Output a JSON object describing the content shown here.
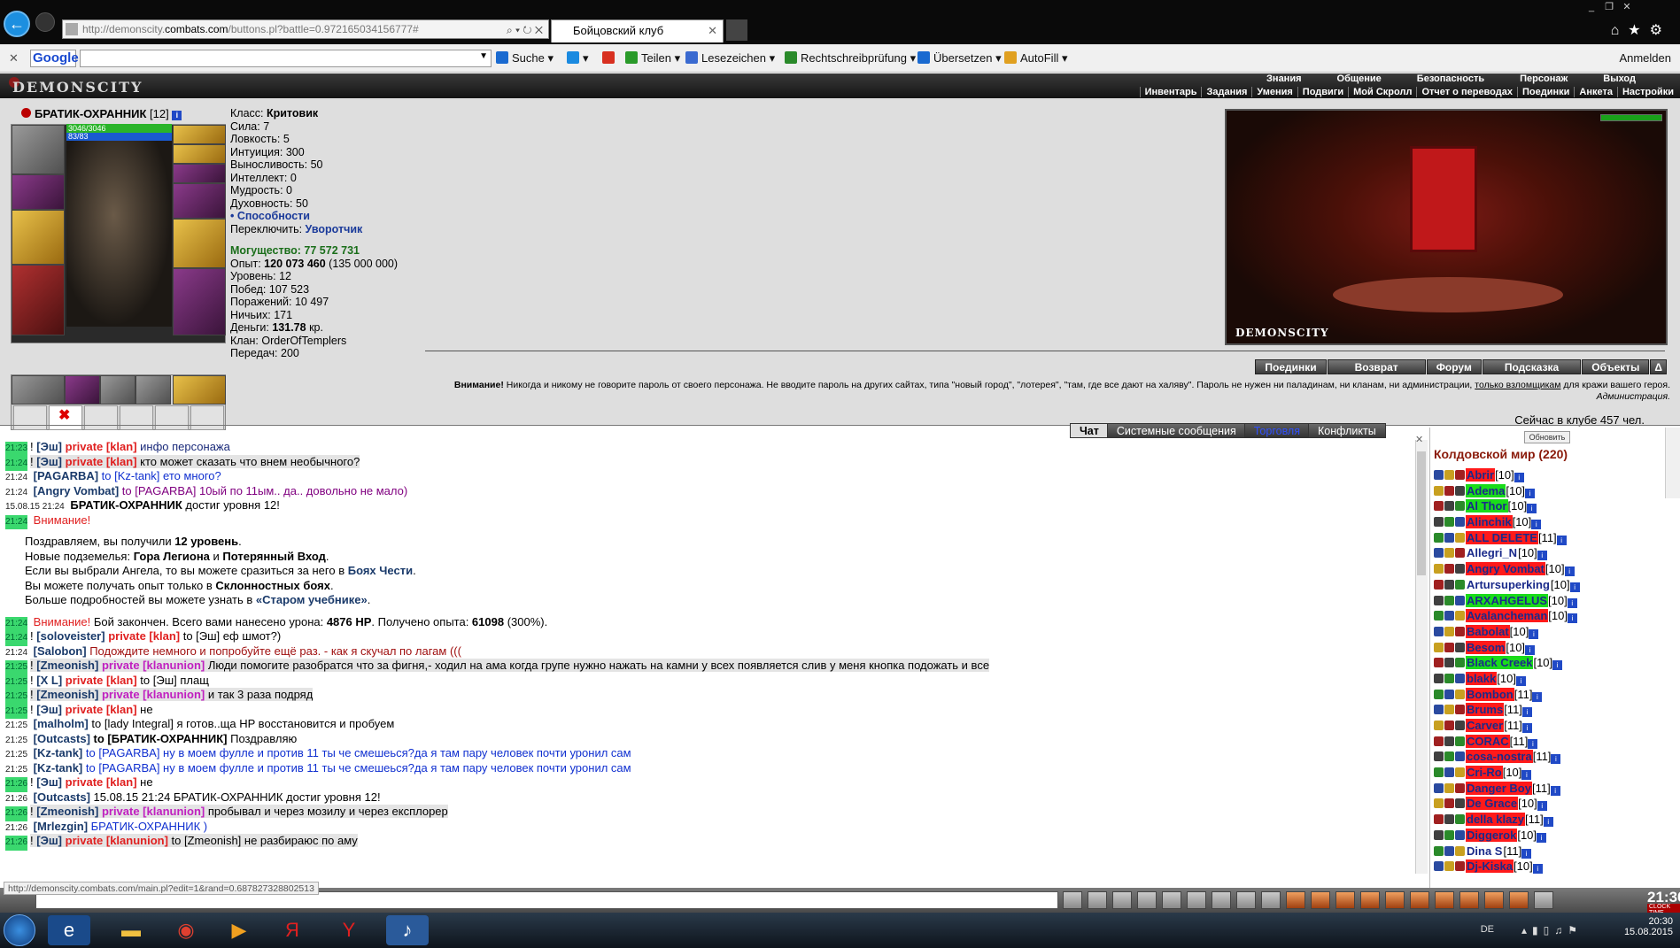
{
  "browser": {
    "url_prefix": "http://demonscity.",
    "url_host": "combats.com",
    "url_rest": "/buttons.pl?battle=0.972165034156777#",
    "tab_title": "Бойцовский клуб",
    "window_controls": [
      "_",
      "❐",
      "✕"
    ]
  },
  "toolbar": {
    "close": "✕",
    "google": "Google",
    "items": [
      {
        "label": "Suche ▾",
        "icon": "search-icon",
        "color": "#1a6ad0"
      },
      {
        "label": "▾",
        "icon": "plus-icon",
        "color": "#1a8ae0"
      },
      {
        "label": "",
        "icon": "gplus-icon",
        "color": "#d83020"
      },
      {
        "label": "Teilen ▾",
        "icon": "share-icon",
        "color": "#2a9a2a"
      },
      {
        "label": "Lesezeichen ▾",
        "icon": "star-icon",
        "color": "#3a6ad0"
      },
      {
        "label": "Rechtschreibprüfung ▾",
        "icon": "spellcheck-icon",
        "color": "#2a8a2a"
      },
      {
        "label": "Übersetzen ▾",
        "icon": "translate-icon",
        "color": "#1a6ad0"
      },
      {
        "label": "AutoFill ▾",
        "icon": "autofill-icon",
        "color": "#e0a020"
      }
    ],
    "signin": "Anmelden"
  },
  "game_header": {
    "logo": "DEMONSCITY",
    "menu_top": [
      "Знания",
      "Общение",
      "Безопасность",
      "Персонаж",
      "Выход"
    ],
    "menu_bottom": [
      "Инвентарь",
      "Задания",
      "Умения",
      "Подвиги",
      "Мой Скролл",
      "Отчет о переводах",
      "Поединки",
      "Анкета",
      "Настройки"
    ]
  },
  "character": {
    "name": "БРАТИК-ОХРАННИК",
    "level": "[12]",
    "hp": "3046/3046",
    "mp": "83/83",
    "stats": [
      {
        "k": "Класс:",
        "v": "Критовик",
        "style": "b"
      },
      {
        "k": "Сила:",
        "v": "7"
      },
      {
        "k": "Ловкость:",
        "v": "5"
      },
      {
        "k": "Интуиция:",
        "v": "300"
      },
      {
        "k": "Выносливость:",
        "v": "50"
      },
      {
        "k": "Интеллект:",
        "v": "0"
      },
      {
        "k": "Мудрость:",
        "v": "0"
      },
      {
        "k": "Духовность:",
        "v": "50"
      }
    ],
    "abilities": "• Способности",
    "switch_label": "Переключить:",
    "switch_value": "Уворотчик",
    "power_label": "Могущество:",
    "power_value": "77 572 731",
    "exp_label": "Опыт:",
    "exp_value": "120 073 460",
    "exp_next": "(135 000 000)",
    "stats2": [
      "Уровень: 12",
      "Побед: 107 523",
      "Поражений: 10 497",
      "Ничьих: 171"
    ],
    "money_label": "Деньги:",
    "money_value": "131.78",
    "money_unit": "кр.",
    "clan": "Клан: OrderOfTemplers",
    "transfers": "Передач: 200"
  },
  "room": {
    "label": "DEMONSCITY"
  },
  "actions": [
    "Поединки",
    "Возврат",
    "Форум",
    "Подсказка",
    "Объекты",
    "Δ"
  ],
  "warning": {
    "lead": "Внимание!",
    "text": "Никогда и никому не говорите пароль от своего персонажа. Не вводите пароль на других сайтах, типа \"новый город\", \"лотерея\", \"там, где все дают на халяву\". Пароль не нужен ни паладинам, ни кланам, ни администрации,",
    "underlined": "только взломщикам",
    "tail": "для кражи вашего героя.",
    "signature": "Администрация."
  },
  "online": "Сейчас в клубе 457 чел.",
  "chat_tabs": [
    "Чат",
    "Системные сообщения",
    "Торговля",
    "Конфликты"
  ],
  "chat": [
    {
      "t": "21:23",
      "g": true,
      "parts": [
        [
          "!",
          ""
        ],
        [
          " [Эш] ",
          "nick"
        ],
        [
          "private [klan]",
          "priv"
        ],
        [
          " инфо персонажа",
          "nav"
        ]
      ]
    },
    {
      "t": "21:24",
      "g": true,
      "parts": [
        [
          "!",
          ""
        ],
        [
          " [Эш] ",
          "nick"
        ],
        [
          "private [klan]",
          "priv"
        ],
        [
          " кто может сказать что внем необычного?",
          ""
        ]
      ],
      "hl": true
    },
    {
      "t": "21:24",
      "g": false,
      "parts": [
        [
          " [PAGARBA] ",
          "nick"
        ],
        [
          "to [Kz-tank] ето много?",
          "blue"
        ]
      ]
    },
    {
      "t": "21:24",
      "g": false,
      "parts": [
        [
          " [Angry Vombat] ",
          "nick"
        ],
        [
          "to [PAGARBA] 10ый по 11ым.. да.. довольно не мало)",
          "purp"
        ]
      ]
    },
    {
      "t": "15.08.15 21:24",
      "g": false,
      "parts": [
        [
          " БРАТИК-ОХРАННИК",
          "bold"
        ],
        [
          " достиг уровня 12!",
          ""
        ]
      ]
    },
    {
      "t": "21:24",
      "g": true,
      "parts": [
        [
          " Внимание!",
          "red"
        ]
      ]
    },
    {
      "blank": true
    },
    {
      "indent": true,
      "parts": [
        [
          "Поздравляем, вы получили ",
          ""
        ],
        [
          "12 уровень",
          "bold"
        ],
        [
          ".",
          ""
        ]
      ]
    },
    {
      "indent": true,
      "parts": [
        [
          "Новые подземелья: ",
          ""
        ],
        [
          "Гора Легиона",
          "bold"
        ],
        [
          " и ",
          ""
        ],
        [
          "Потерянный Вход",
          "bold"
        ],
        [
          ".",
          ""
        ]
      ]
    },
    {
      "indent": true,
      "parts": [
        [
          "Если вы выбрали Ангела, то вы можете сразиться за него в ",
          ""
        ],
        [
          "Боях Чести",
          "nick"
        ],
        [
          ".",
          ""
        ]
      ]
    },
    {
      "indent": true,
      "parts": [
        [
          "Вы можете получать опыт только в ",
          ""
        ],
        [
          "Склонностных боях",
          "bold"
        ],
        [
          ".",
          ""
        ]
      ]
    },
    {
      "indent": true,
      "parts": [
        [
          "Больше подробностей вы можете узнать в ",
          ""
        ],
        [
          "«Старом учебнике»",
          "nick"
        ],
        [
          ".",
          ""
        ]
      ]
    },
    {
      "blank": true
    },
    {
      "t": "21:24",
      "g": true,
      "parts": [
        [
          " Внимание!",
          "red"
        ],
        [
          " Бой закончен. Всего вами нанесено урона: ",
          ""
        ],
        [
          "4876 HP",
          "bold"
        ],
        [
          ". Получено опыта: ",
          ""
        ],
        [
          "61098",
          "bold"
        ],
        [
          " (300%).",
          ""
        ]
      ]
    },
    {
      "t": "21:24",
      "g": true,
      "parts": [
        [
          "!",
          ""
        ],
        [
          " [soloveister] ",
          "nick"
        ],
        [
          "private [klan]",
          "priv"
        ],
        [
          " to [Эш] еф шмот?)",
          ""
        ]
      ]
    },
    {
      "t": "21:24",
      "g": false,
      "parts": [
        [
          " [Salobon] ",
          "nick"
        ],
        [
          "Подождите немного и попробуйте ещё раз. - как я скучал по лагам (((",
          "darkred"
        ]
      ]
    },
    {
      "t": "21:25",
      "g": true,
      "parts": [
        [
          "!",
          ""
        ],
        [
          " [Zmeonish] ",
          "nick"
        ],
        [
          "private [klanunion]",
          "privm"
        ],
        [
          " Люди помогите разобратся что за фигня,- ходил на ама когда групе нужно нажать на камни у всех появляется слив у меня кнопка подожать и все",
          ""
        ]
      ],
      "hl": true
    },
    {
      "t": "21:25",
      "g": true,
      "parts": [
        [
          "!",
          ""
        ],
        [
          " [X L] ",
          "nick"
        ],
        [
          "private [klan]",
          "priv"
        ],
        [
          " to [Эш] плащ",
          ""
        ]
      ]
    },
    {
      "t": "21:25",
      "g": true,
      "parts": [
        [
          "!",
          ""
        ],
        [
          " [Zmeonish] ",
          "nick"
        ],
        [
          "private [klanunion]",
          "privm"
        ],
        [
          " и так 3 раза подряд",
          ""
        ]
      ],
      "hl": true
    },
    {
      "t": "21:25",
      "g": true,
      "parts": [
        [
          "!",
          ""
        ],
        [
          " [Эш] ",
          "nick"
        ],
        [
          "private [klan]",
          "priv"
        ],
        [
          " не",
          ""
        ]
      ]
    },
    {
      "t": "21:25",
      "g": false,
      "parts": [
        [
          " [malholm] ",
          "nick"
        ],
        [
          "to [lady Integral] я готов..ща HP восстановится и пробуем",
          ""
        ]
      ]
    },
    {
      "t": "21:25",
      "g": false,
      "parts": [
        [
          " [Outcasts] ",
          "nick"
        ],
        [
          "to [БРАТИК-ОХРАННИК]",
          "bold"
        ],
        [
          " Поздравляю",
          ""
        ]
      ]
    },
    {
      "t": "21:25",
      "g": false,
      "parts": [
        [
          " [Kz-tank] ",
          "nick"
        ],
        [
          "to [PAGARBA] ну в моем фулле и против 11 ты че смешеься?да я там пару человек почти уронил сам",
          "blue"
        ]
      ]
    },
    {
      "t": "21:25",
      "g": false,
      "parts": [
        [
          " [Kz-tank] ",
          "nick"
        ],
        [
          "to [PAGARBA] ну в моем фулле и против 11 ты че смешеься?да я там пару человек почти уронил сам",
          "blue"
        ]
      ]
    },
    {
      "t": "21:26",
      "g": true,
      "parts": [
        [
          "!",
          ""
        ],
        [
          " [Эш] ",
          "nick"
        ],
        [
          "private [klan]",
          "priv"
        ],
        [
          " не",
          ""
        ]
      ]
    },
    {
      "t": "21:26",
      "g": false,
      "parts": [
        [
          " [Outcasts] ",
          "nick"
        ],
        [
          "15.08.15 21:24 БРАТИК-ОХРАННИК достиг уровня 12!",
          ""
        ]
      ]
    },
    {
      "t": "21:26",
      "g": true,
      "parts": [
        [
          "!",
          ""
        ],
        [
          " [Zmeonish] ",
          "nick"
        ],
        [
          "private [klanunion]",
          "privm"
        ],
        [
          " пробывал и через мозилу и через експлорер",
          ""
        ]
      ],
      "hl": true
    },
    {
      "t": "21:26",
      "g": false,
      "parts": [
        [
          " [Mrlezgin] ",
          "nick"
        ],
        [
          "БРАТИК-ОХРАННИК )",
          "blue"
        ]
      ]
    },
    {
      "t": "21:26",
      "g": true,
      "parts": [
        [
          "!",
          ""
        ],
        [
          " [Эш] ",
          "nick"
        ],
        [
          "private [klanunion]",
          "priv"
        ],
        [
          " to [Zmeonish] не разбираюс по аму",
          ""
        ]
      ],
      "hl": true
    }
  ],
  "right": {
    "refresh": "Обновить",
    "title": "Колдовской мир (220)",
    "players": [
      {
        "name": "Abrir",
        "lvl": "[10]",
        "bg": "r"
      },
      {
        "name": "Adema",
        "lvl": "[10]",
        "bg": "g"
      },
      {
        "name": "Al Thor",
        "lvl": "[10]",
        "bg": "g"
      },
      {
        "name": "Alinchik",
        "lvl": "[10]",
        "bg": "r"
      },
      {
        "name": "ALL DELETE",
        "lvl": "[11]",
        "bg": "r"
      },
      {
        "name": "Allegri_N",
        "lvl": "[10]",
        "bg": ""
      },
      {
        "name": "Angry Vombat",
        "lvl": "[10]",
        "bg": "r"
      },
      {
        "name": "Artursuperking",
        "lvl": "[10]",
        "bg": ""
      },
      {
        "name": "ARXAHGELUS",
        "lvl": "[10]",
        "bg": "g"
      },
      {
        "name": "Avalancheman",
        "lvl": "[10]",
        "bg": "r"
      },
      {
        "name": "Babolat",
        "lvl": "[10]",
        "bg": "r"
      },
      {
        "name": "Besom",
        "lvl": "[10]",
        "bg": "r"
      },
      {
        "name": "Black Creek",
        "lvl": "[10]",
        "bg": "g"
      },
      {
        "name": "blakk",
        "lvl": "[10]",
        "bg": "r"
      },
      {
        "name": "Bombon",
        "lvl": "[11]",
        "bg": "r"
      },
      {
        "name": "Brums",
        "lvl": "[11]",
        "bg": "r"
      },
      {
        "name": "Carver",
        "lvl": "[11]",
        "bg": "r"
      },
      {
        "name": "CORAC",
        "lvl": "[11]",
        "bg": "r"
      },
      {
        "name": "cosa-nostra",
        "lvl": "[11]",
        "bg": "r"
      },
      {
        "name": "Cri-Ro",
        "lvl": "[10]",
        "bg": "r"
      },
      {
        "name": "Danger Boy",
        "lvl": "[11]",
        "bg": "r"
      },
      {
        "name": "De Grace",
        "lvl": "[10]",
        "bg": "r"
      },
      {
        "name": "della klazy",
        "lvl": "[11]",
        "bg": "r"
      },
      {
        "name": "Diggerok",
        "lvl": "[10]",
        "bg": "r"
      },
      {
        "name": "Dina S",
        "lvl": "[11]",
        "bg": ""
      },
      {
        "name": "Dj-Kiska",
        "lvl": "[10]",
        "bg": "r"
      }
    ]
  },
  "bottom": {
    "status_url": "http://demonscity.combats.com/main.pl?edit=1&rand=0.687827328802513",
    "clock": "21:30",
    "clock_label": "CLOCK  TIME"
  },
  "taskbar": {
    "time": "20:30",
    "date": "15.08.2015",
    "lang": "DE"
  }
}
